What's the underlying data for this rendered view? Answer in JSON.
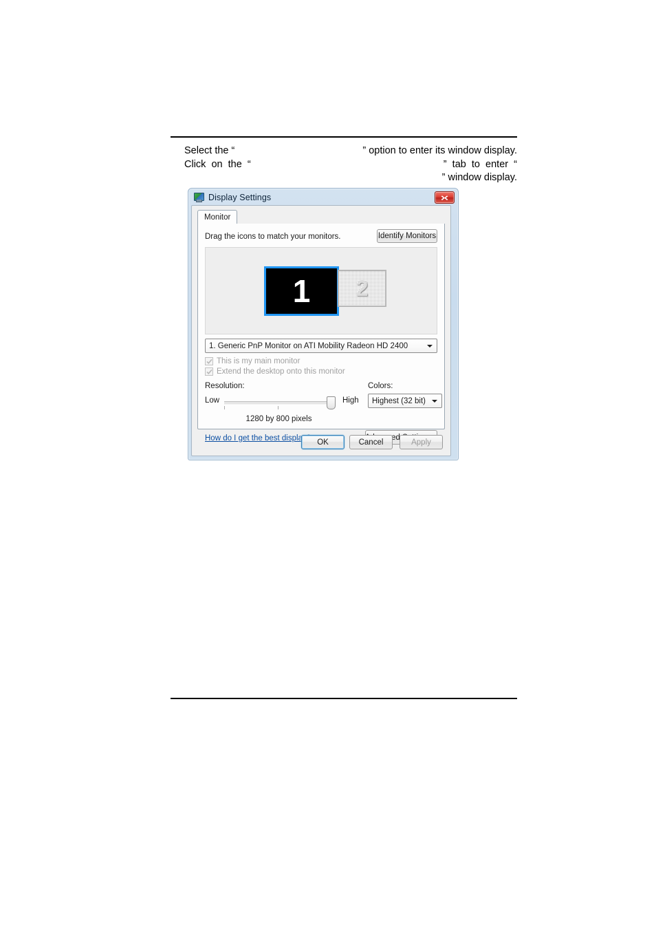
{
  "page": {
    "instructions": {
      "line1_a": "Select the “",
      "line1_blank": "",
      "line1_b": "” option to enter its window display.",
      "line2_a": "Click  on  the  “",
      "line2_blank": "",
      "line2_b": "”  tab  to  enter  “",
      "line3_b": "” window display."
    }
  },
  "dialog": {
    "title": "Display Settings",
    "title_icon": "monitor-icon",
    "close_label": "Close",
    "tabs": [
      {
        "label": "Monitor",
        "selected": true
      }
    ],
    "hint": "Drag the icons to match your monitors.",
    "identify_button": "Identify Monitors",
    "identify_button_accel": "I",
    "monitors": [
      {
        "number": "1",
        "state": "selected-active"
      },
      {
        "number": "2",
        "state": "disabled-hatched"
      }
    ],
    "monitor_select": {
      "value": "1. Generic PnP Monitor on ATI Mobility Radeon HD 2400"
    },
    "checkboxes": [
      {
        "label": "This is my main monitor",
        "accel": "T",
        "checked": true,
        "enabled": false
      },
      {
        "label": "Extend the desktop onto this monitor",
        "accel": "E",
        "checked": true,
        "enabled": false
      }
    ],
    "resolution": {
      "label": "Resolution:",
      "accel": "R",
      "low_label": "Low",
      "high_label": "High",
      "value_text": "1280 by 800 pixels",
      "slider_position_pct": 94
    },
    "colors": {
      "label": "Colors:",
      "accel": "C",
      "value": "Highest (32 bit)"
    },
    "help_link": "How do I get the best display?",
    "advanced_button": "Advanced Settings...",
    "advanced_button_accel": "v",
    "footer_buttons": [
      {
        "name": "ok",
        "label": "OK",
        "default": true,
        "enabled": true
      },
      {
        "name": "cancel",
        "label": "Cancel",
        "default": false,
        "enabled": true
      },
      {
        "name": "apply",
        "label": "Apply",
        "accel": "A",
        "default": false,
        "enabled": false
      }
    ]
  },
  "colors": {
    "accent_blue": "#2196f3",
    "title_frame": "#d3e2f0",
    "close_red": "#d93b30",
    "link_blue": "#0b4ea2",
    "disabled_text": "#a0a0a0"
  }
}
